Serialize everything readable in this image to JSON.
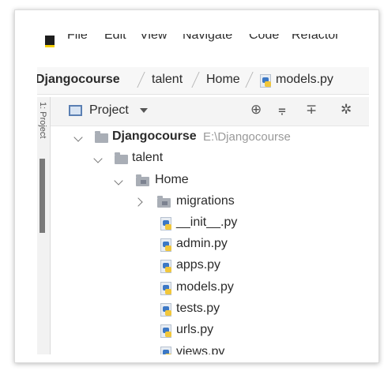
{
  "menu": {
    "items": [
      "File",
      "Edit",
      "View",
      "Navigate",
      "Code",
      "Refactor"
    ]
  },
  "breadcrumb": {
    "items": [
      "Djangocourse",
      "talent",
      "Home",
      "models.py"
    ]
  },
  "tool_strip": {
    "label": "1: Project"
  },
  "project_panel": {
    "title": "Project",
    "icons": [
      "locate-icon",
      "collapse-all-icon",
      "expand-all-icon",
      "settings-gear-icon"
    ]
  },
  "tree": {
    "root": {
      "label": "Djangocourse",
      "path": "E:\\Djangocourse"
    },
    "talent": {
      "label": "talent"
    },
    "home": {
      "label": "Home"
    },
    "migrations": {
      "label": "migrations"
    },
    "files": [
      "__init__.py",
      "admin.py",
      "apps.py",
      "models.py",
      "tests.py",
      "urls.py",
      "views.py"
    ]
  },
  "colors": {
    "folder": "#a9aeb6",
    "python_blue": "#3c78c5",
    "python_yellow": "#f2c73b",
    "path_gray": "#9a9a9a"
  }
}
